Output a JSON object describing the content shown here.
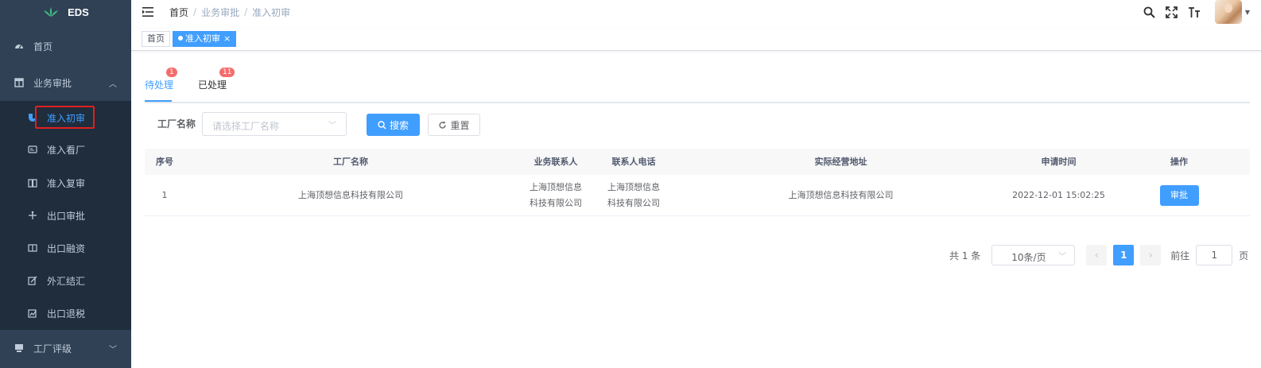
{
  "app": {
    "title": "EDS"
  },
  "sidebar": {
    "home": {
      "label": "首页",
      "icon": "dashboard-icon"
    },
    "group": {
      "label": "业务审批",
      "icon": "table-icon"
    },
    "sub_items": [
      {
        "label": "准入初审",
        "icon": "shield-icon"
      },
      {
        "label": "准入看厂",
        "icon": "id-card-icon"
      },
      {
        "label": "准入复审",
        "icon": "book-icon"
      },
      {
        "label": "出口审批",
        "icon": "anchor-icon"
      },
      {
        "label": "出口融资",
        "icon": "columns-icon"
      },
      {
        "label": "外汇结汇",
        "icon": "edit-icon"
      },
      {
        "label": "出口退税",
        "icon": "chart-edit-icon"
      }
    ],
    "collapsed_group": {
      "label": "工厂评级",
      "icon": "monitor-icon"
    },
    "accent": "#409eff"
  },
  "header": {
    "breadcrumb": [
      "首页",
      "业务审批",
      "准入初审"
    ],
    "icons": [
      "search-icon",
      "fullscreen-icon",
      "font-size-icon"
    ]
  },
  "tags": {
    "home": "首页",
    "active": "准入初审"
  },
  "tabs": [
    {
      "label": "待处理",
      "badge": "1"
    },
    {
      "label": "已处理",
      "badge": "11"
    }
  ],
  "search": {
    "label": "工厂名称",
    "placeholder": "请选择工厂名称",
    "search_label": "搜索",
    "reset_label": "重置"
  },
  "table": {
    "columns": [
      "序号",
      "工厂名称",
      "业务联系人",
      "联系人电话",
      "实际经营地址",
      "申请时间",
      "操作"
    ],
    "rows": [
      {
        "no": "1",
        "name": "上海顶想信息科技有限公司",
        "contact_line1": "上海顶想信息",
        "contact_line2": "科技有限公司",
        "phone_line1": "上海顶想信息",
        "phone_line2": "科技有限公司",
        "address": "上海顶想信息科技有限公司",
        "date": "2022-12-01 15:02:25",
        "action": "审批"
      }
    ]
  },
  "pagination": {
    "total": "共 1 条",
    "page_size": "10条/页",
    "prev": "‹",
    "current": "1",
    "next": "›",
    "goto_label": "前往",
    "goto_value": "1",
    "page_unit": "页"
  }
}
